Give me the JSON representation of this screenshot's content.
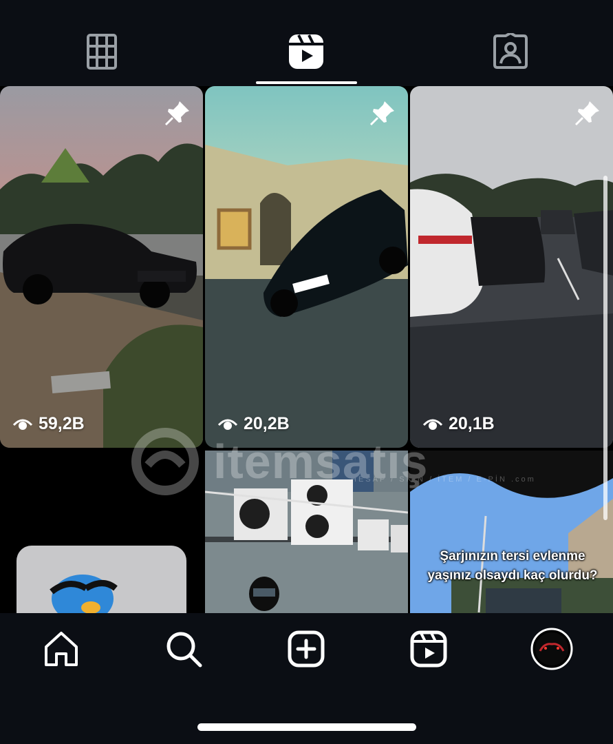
{
  "tabs": [
    {
      "name": "grid",
      "icon": "grid-icon"
    },
    {
      "name": "reels",
      "icon": "reels-icon",
      "active": true
    },
    {
      "name": "tagged",
      "icon": "tagged-icon"
    }
  ],
  "posts": [
    {
      "views": "59,2B",
      "pinned": true
    },
    {
      "views": "20,2B",
      "pinned": true
    },
    {
      "views": "20,1B",
      "pinned": true
    },
    {
      "views": ""
    },
    {
      "views": ""
    },
    {
      "caption": "Şarjınızın tersi evlenme yaşınız olsaydı kaç olurdu?"
    }
  ],
  "watermark": {
    "text": "itemsatış",
    "sub": "HESAP / SKIN / İTEM / E-PİN",
    "domain": ".com"
  },
  "bottom_nav": [
    {
      "name": "home",
      "icon": "home-icon"
    },
    {
      "name": "search",
      "icon": "search-icon"
    },
    {
      "name": "create",
      "icon": "plus-square-icon"
    },
    {
      "name": "reels",
      "icon": "reels-icon"
    },
    {
      "name": "profile",
      "icon": "avatar"
    }
  ],
  "colors": {
    "background": "#0b0e14",
    "accent": "#ffffff"
  }
}
